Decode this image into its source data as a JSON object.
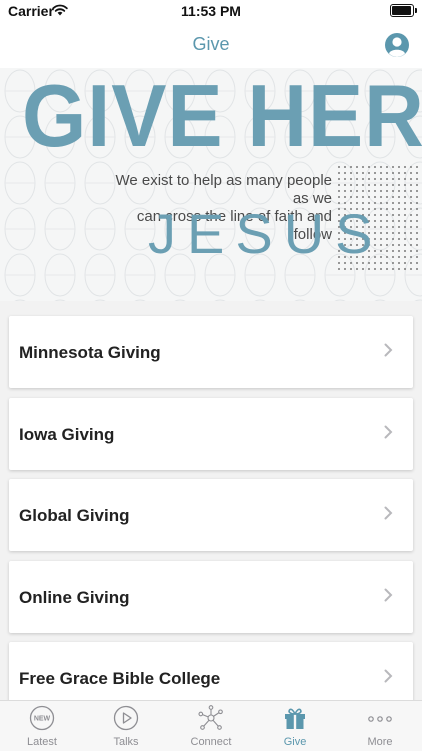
{
  "status_bar": {
    "carrier": "Carrier",
    "time": "11:53 PM"
  },
  "nav": {
    "title": "Give"
  },
  "banner": {
    "headline": "GIVE HERE",
    "tagline_line1": "We exist to help as many people as we",
    "tagline_line2": "can cross the line of faith and follow",
    "emphasis": "JESUS"
  },
  "giving_options": [
    {
      "label": "Minnesota Giving"
    },
    {
      "label": "Iowa Giving"
    },
    {
      "label": "Global Giving"
    },
    {
      "label": "Online Giving"
    },
    {
      "label": "Free Grace Bible College"
    }
  ],
  "tabs": [
    {
      "label": "Latest",
      "icon": "new-badge-icon"
    },
    {
      "label": "Talks",
      "icon": "play-circle-icon"
    },
    {
      "label": "Connect",
      "icon": "network-icon"
    },
    {
      "label": "Give",
      "icon": "gift-icon"
    },
    {
      "label": "More",
      "icon": "more-dots-icon"
    }
  ],
  "colors": {
    "accent": "#5b97ad",
    "banner_blue": "#6b9fb3",
    "inactive": "#8e8e93"
  }
}
